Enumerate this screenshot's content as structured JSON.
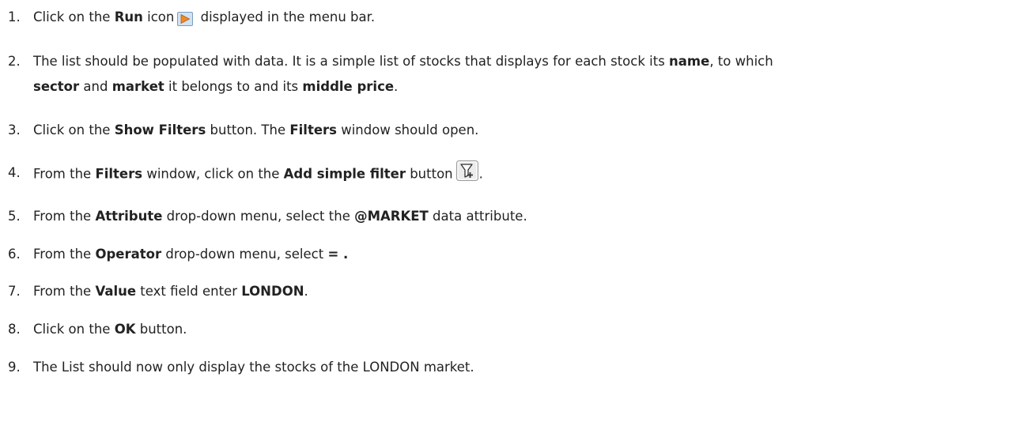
{
  "steps": [
    {
      "num": "1.",
      "p1": "Click on the ",
      "b1": "Run",
      "p2": " icon",
      "icon": "run-icon",
      "p3": " displayed in the menu bar."
    },
    {
      "num": "2.",
      "line1_p1": "The list should be populated with data. It is a simple list of stocks that displays for each stock its ",
      "line1_b1": "name",
      "line1_p2": ", to which",
      "line2_b1": "sector",
      "line2_p1": " and ",
      "line2_b2": "market",
      "line2_p2": " it belongs to and its ",
      "line2_b3": "middle price",
      "line2_p3": "."
    },
    {
      "num": "3.",
      "p1": "Click on the ",
      "b1": "Show Filters",
      "p2": " button. The ",
      "b2": "Filters",
      "p3": " window should open."
    },
    {
      "num": "4.",
      "p1": "From the ",
      "b1": "Filters",
      "p2": " window, click on the ",
      "b2": "Add simple filter",
      "p3": " button",
      "icon": "add-filter-icon",
      "p4": "."
    },
    {
      "num": "5.",
      "p1": "From the ",
      "b1": "Attribute",
      "p2": " drop-down menu, select the ",
      "b2": "@MARKET",
      "p3": " data attribute."
    },
    {
      "num": "6.",
      "p1": "From the ",
      "b1": "Operator",
      "p2": " drop-down menu, select ",
      "b2": "= ."
    },
    {
      "num": "7.",
      "p1": "From the ",
      "b1": "Value",
      "p2": " text field enter ",
      "b2": "LONDON",
      "p3": "."
    },
    {
      "num": "8.",
      "p1": "Click on the ",
      "b1": "OK",
      "p2": " button."
    },
    {
      "num": "9.",
      "p1": "The List should now only display the stocks of the LONDON market."
    }
  ],
  "colors": {
    "text": "#222222",
    "run_icon_fill": "#f08a24",
    "run_icon_bg": "#cfe3f5",
    "filter_icon_bg": "#e8e8e8"
  }
}
